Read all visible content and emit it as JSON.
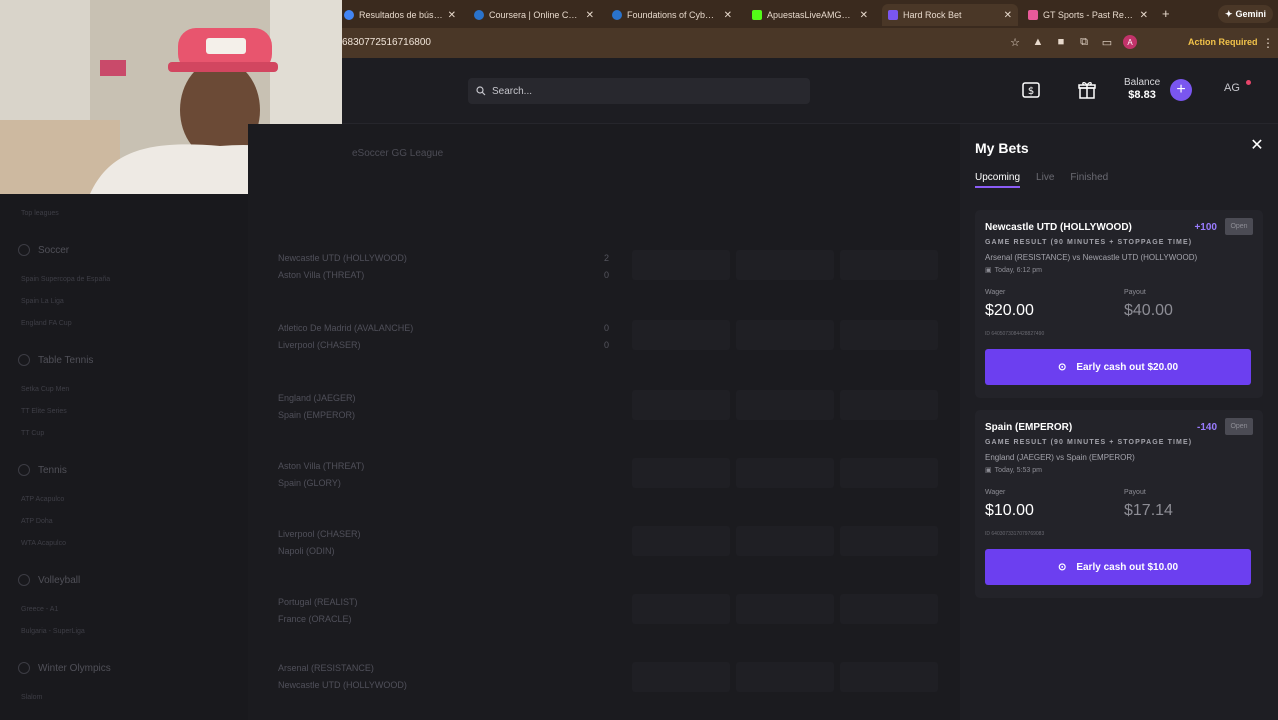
{
  "browser": {
    "tabs": [
      {
        "title": "Resultados de búsqueda",
        "color": "#4285f4"
      },
      {
        "title": "Coursera | Online Courses",
        "color": "#2a73cc"
      },
      {
        "title": "Foundations of Cybersecurity",
        "color": "#2a73cc"
      },
      {
        "title": "ApuestasLiveAMG_USA",
        "color": "#53fc18"
      },
      {
        "title": "Hard Rock Bet",
        "color": "#7a56f0"
      },
      {
        "title": "GT Sports - Past Results",
        "color": "#e85a9a"
      }
    ],
    "new_tab": "+",
    "gemini_label": "Gemini",
    "url": "6830772516716800",
    "profile_initial": "A",
    "action_required": "Action Required"
  },
  "header": {
    "search_placeholder": "Search...",
    "balance_label": "Balance",
    "balance_value": "$8.83",
    "user_initials": "AG"
  },
  "sidebar": {
    "sections": [
      {
        "title": "Soccer",
        "items": [
          "Spain Supercopa de España",
          "Spain La Liga",
          "England FA Cup"
        ]
      },
      {
        "title": "Table Tennis",
        "items": [
          "Setka Cup Men",
          "TT Elite Series",
          "TT Cup"
        ]
      },
      {
        "title": "Tennis",
        "items": [
          "ATP Acapulco",
          "ATP Doha",
          "WTA Acapulco"
        ]
      },
      {
        "title": "Volleyball",
        "items": [
          "Greece - A1",
          "Bulgaria - SuperLiga"
        ]
      },
      {
        "title": "Winter Olympics",
        "items": [
          "Slalom"
        ]
      }
    ]
  },
  "main": {
    "league": "eSoccer GG League",
    "matches": [
      {
        "home": "Newcastle UTD (HOLLYWOOD)",
        "away": "Aston Villa (THREAT)",
        "score_home": "2",
        "score_away": "0"
      },
      {
        "home": "Atletico De Madrid (AVALANCHE)",
        "away": "Liverpool (CHASER)",
        "score_home": "0",
        "score_away": "0"
      },
      {
        "home": "England (JAEGER)",
        "away": "Spain (EMPEROR)",
        "score_home": "",
        "score_away": ""
      },
      {
        "home": "Aston Villa (THREAT)",
        "away": "Spain (GLORY)",
        "score_home": "",
        "score_away": ""
      },
      {
        "home": "Liverpool (CHASER)",
        "away": "Napoli (ODIN)",
        "score_home": "",
        "score_away": ""
      },
      {
        "home": "Portugal (REALIST)",
        "away": "France (ORACLE)",
        "score_home": "",
        "score_away": ""
      },
      {
        "home": "Arsenal (RESISTANCE)",
        "away": "Newcastle UTD (HOLLYWOOD)",
        "score_home": "",
        "score_away": ""
      }
    ]
  },
  "my_bets": {
    "title": "My Bets",
    "close_icon": "close-icon",
    "tabs": [
      "Upcoming",
      "Live",
      "Finished"
    ],
    "active_tab": "Upcoming",
    "wager_label": "Wager",
    "payout_label": "Payout",
    "bets": [
      {
        "selection": "Newcastle UTD (HOLLYWOOD)",
        "odds": "+100",
        "status": "Open",
        "market": "GAME RESULT (90 MINUTES + STOPPAGE TIME)",
        "match": "Arsenal (RESISTANCE) vs Newcastle UTD (HOLLYWOOD)",
        "time": "Today, 6:12 pm",
        "wager": "$20.00",
        "payout": "$40.00",
        "bet_id": "ID 6405073084428827490",
        "cashout": "Early cash out $20.00"
      },
      {
        "selection": "Spain (EMPEROR)",
        "odds": "-140",
        "status": "Open",
        "market": "GAME RESULT (90 MINUTES + STOPPAGE TIME)",
        "match": "England (JAEGER) vs Spain (EMPEROR)",
        "time": "Today, 5:53 pm",
        "wager": "$10.00",
        "payout": "$17.14",
        "bet_id": "ID 6403073317079769083",
        "cashout": "Early cash out $10.00"
      }
    ]
  },
  "colors": {
    "accent": "#7a56f0",
    "button": "#6c3ff0",
    "odds": "#9a7cff"
  }
}
